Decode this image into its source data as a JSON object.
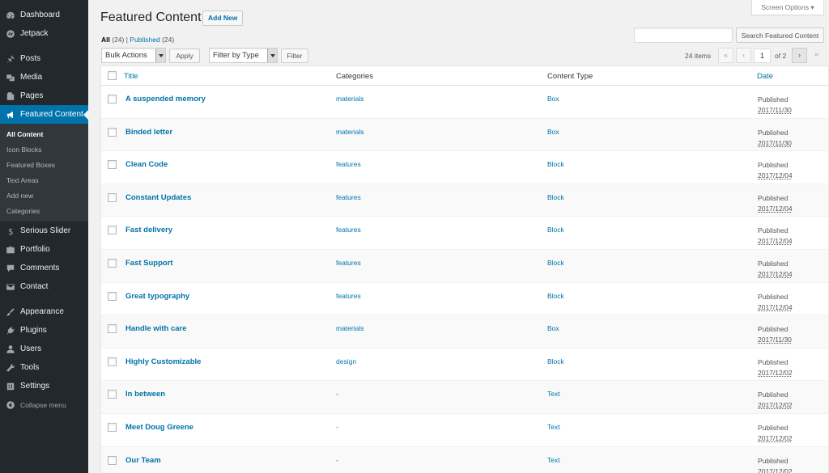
{
  "sidebar": {
    "items": [
      {
        "label": "Dashboard",
        "icon": "dashboard-icon"
      },
      {
        "label": "Jetpack",
        "icon": "jetpack-icon"
      },
      {
        "label": "Posts",
        "icon": "pin-icon"
      },
      {
        "label": "Media",
        "icon": "media-icon"
      },
      {
        "label": "Pages",
        "icon": "pages-icon"
      },
      {
        "label": "Featured Content",
        "icon": "megaphone-icon"
      }
    ],
    "submenu": [
      "All Content",
      "Icon Blocks",
      "Featured Boxes",
      "Text Areas",
      "Add new",
      "Categories"
    ],
    "items2": [
      {
        "label": "Serious Slider",
        "icon": "dollar-icon"
      },
      {
        "label": "Portfolio",
        "icon": "portfolio-icon"
      },
      {
        "label": "Comments",
        "icon": "comments-icon"
      },
      {
        "label": "Contact",
        "icon": "mail-icon"
      }
    ],
    "items3": [
      {
        "label": "Appearance",
        "icon": "brush-icon"
      },
      {
        "label": "Plugins",
        "icon": "plugin-icon"
      },
      {
        "label": "Users",
        "icon": "users-icon"
      },
      {
        "label": "Tools",
        "icon": "wrench-icon"
      },
      {
        "label": "Settings",
        "icon": "settings-icon"
      }
    ],
    "collapse_label": "Collapse menu"
  },
  "header": {
    "title": "Featured Content",
    "add_new": "Add New",
    "screen_options": "Screen Options ▾"
  },
  "filters": {
    "all_label": "All",
    "all_count": "(24)",
    "sep": "|",
    "published_label": "Published",
    "published_count": "(24)"
  },
  "search": {
    "value": "",
    "button": "Search Featured Content"
  },
  "toolbar": {
    "bulk_actions": "Bulk Actions",
    "apply": "Apply",
    "filter_by_type": "Filter by Type",
    "filter": "Filter"
  },
  "pagination": {
    "items": "24 items",
    "first": "«",
    "prev": "‹",
    "current": "1",
    "of": "of 2",
    "next": "›",
    "last": "»"
  },
  "table": {
    "columns": [
      "Title",
      "Categories",
      "Content Type",
      "Date"
    ],
    "rows": [
      {
        "title": "A suspended memory",
        "category": "materials",
        "type": "Box",
        "status": "Published",
        "date": "2017/11/30"
      },
      {
        "title": "Binded letter",
        "category": "materials",
        "type": "Box",
        "status": "Published",
        "date": "2017/11/30"
      },
      {
        "title": "Clean Code",
        "category": "features",
        "type": "Block",
        "status": "Published",
        "date": "2017/12/04"
      },
      {
        "title": "Constant Updates",
        "category": "features",
        "type": "Block",
        "status": "Published",
        "date": "2017/12/04"
      },
      {
        "title": "Fast delivery",
        "category": "features",
        "type": "Block",
        "status": "Published",
        "date": "2017/12/04"
      },
      {
        "title": "Fast Support",
        "category": "features",
        "type": "Block",
        "status": "Published",
        "date": "2017/12/04"
      },
      {
        "title": "Great typography",
        "category": "features",
        "type": "Block",
        "status": "Published",
        "date": "2017/12/04"
      },
      {
        "title": "Handle with care",
        "category": "materials",
        "type": "Box",
        "status": "Published",
        "date": "2017/11/30"
      },
      {
        "title": "Highly Customizable",
        "category": "design",
        "type": "Block",
        "status": "Published",
        "date": "2017/12/02"
      },
      {
        "title": "In between",
        "category": "-",
        "type": "Text",
        "status": "Published",
        "date": "2017/12/02"
      },
      {
        "title": "Meet Doug Greene",
        "category": "-",
        "type": "Text",
        "status": "Published",
        "date": "2017/12/02"
      },
      {
        "title": "Our Team",
        "category": "-",
        "type": "Text",
        "status": "Published",
        "date": "2017/12/02"
      }
    ]
  }
}
